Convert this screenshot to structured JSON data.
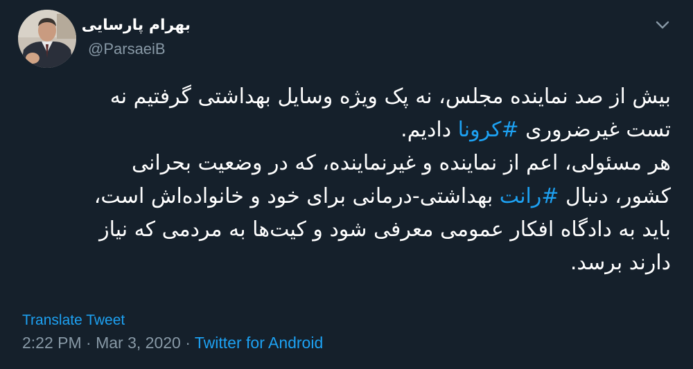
{
  "author": {
    "display_name": "بهرام پارسایی",
    "handle": "@ParsaeiB"
  },
  "tweet": {
    "lines": [
      [
        {
          "text": "بیش از صد نماینده مجلس، نه پک ویژه وسایل بهداشتی گرفتیم نه"
        }
      ],
      [
        {
          "text": "تست غیرضروری "
        },
        {
          "text": "#کرونا",
          "hashtag": true
        },
        {
          "text": " دادیم."
        }
      ],
      [
        {
          "text": "هر مسئولی، اعم از نماینده و غیرنماینده، که در وضعیت بحرانی"
        }
      ],
      [
        {
          "text": "کشور، دنبال "
        },
        {
          "text": "#رانت",
          "hashtag": true
        },
        {
          "text": " بهداشتی-درمانی برای خود و خانواده‌اش است،"
        }
      ],
      [
        {
          "text": "باید به دادگاه افکار عمومی معرفی شود و کیت‌ها به مردمی که نیاز"
        }
      ],
      [
        {
          "text": "دارند برسد."
        }
      ]
    ]
  },
  "actions": {
    "translate_label": "Translate Tweet"
  },
  "meta": {
    "time": "2:22 PM",
    "separator": " · ",
    "date": "Mar 3, 2020",
    "source": "Twitter for Android"
  },
  "icons": {
    "menu": "chevron-down-icon",
    "avatar": "profile-photo"
  },
  "colors": {
    "background": "#15202b",
    "text_primary": "#ffffff",
    "text_secondary": "#8899a6",
    "accent": "#1da1f2"
  }
}
